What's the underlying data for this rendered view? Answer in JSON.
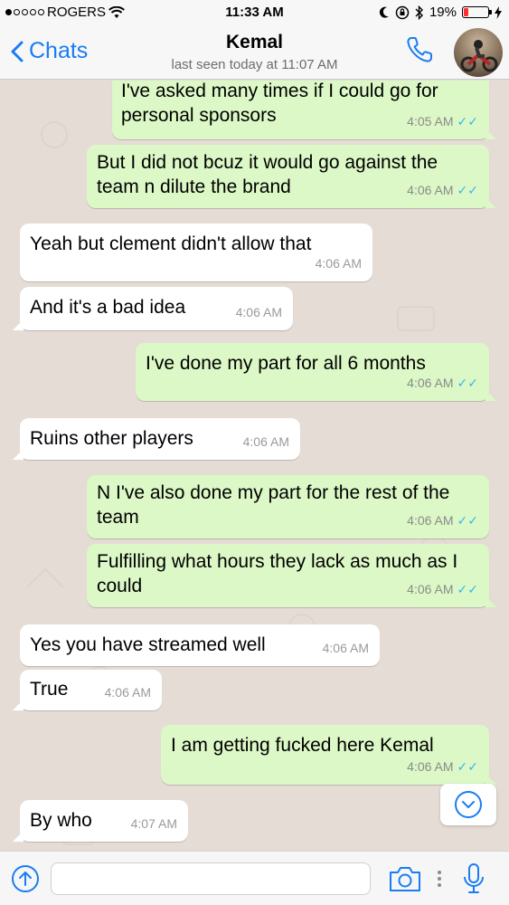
{
  "status_bar": {
    "carrier": "ROGERS",
    "time": "11:33 AM",
    "battery": "19%",
    "battery_level": 0.19
  },
  "header": {
    "back_label": "Chats",
    "contact_name": "Kemal",
    "last_seen": "last seen today at 11:07 AM"
  },
  "messages": [
    {
      "dir": "out",
      "text": "I've asked many times if I could go for personal sponsors",
      "time": "4:05 AM",
      "ticks": "✓✓"
    },
    {
      "dir": "out",
      "text": "But I did not bcuz it would go against the team n dilute the brand",
      "time": "4:06 AM",
      "ticks": "✓✓"
    },
    {
      "dir": "in",
      "text": "Yeah but clement didn't allow that",
      "time": "4:06 AM"
    },
    {
      "dir": "in",
      "text": "And it's a bad idea",
      "time": "4:06 AM"
    },
    {
      "dir": "out",
      "text": "I've done my part for all 6 months",
      "time": "4:06 AM",
      "ticks": "✓✓"
    },
    {
      "dir": "in",
      "text": "Ruins other players",
      "time": "4:06 AM"
    },
    {
      "dir": "out",
      "text": "N I've also done my part for the rest of the team",
      "time": "4:06 AM",
      "ticks": "✓✓"
    },
    {
      "dir": "out",
      "text": "Fulfilling what hours they lack as much as I could",
      "time": "4:06 AM",
      "ticks": "✓✓"
    },
    {
      "dir": "in",
      "text": "Yes you have streamed well",
      "time": "4:06 AM"
    },
    {
      "dir": "in",
      "text": "True",
      "time": "4:06 AM"
    },
    {
      "dir": "out",
      "text": "I am getting fucked here Kemal",
      "time": "4:06 AM",
      "ticks": "✓✓"
    },
    {
      "dir": "in",
      "text": "By who",
      "time": "4:07 AM"
    }
  ],
  "composer": {
    "placeholder": ""
  },
  "colors": {
    "accent": "#1a7cf4",
    "outgoing_bubble": "#dcf8c6",
    "incoming_bubble": "#ffffff",
    "read_ticks": "#34b7f1",
    "battery_low": "#ff2d2d"
  }
}
